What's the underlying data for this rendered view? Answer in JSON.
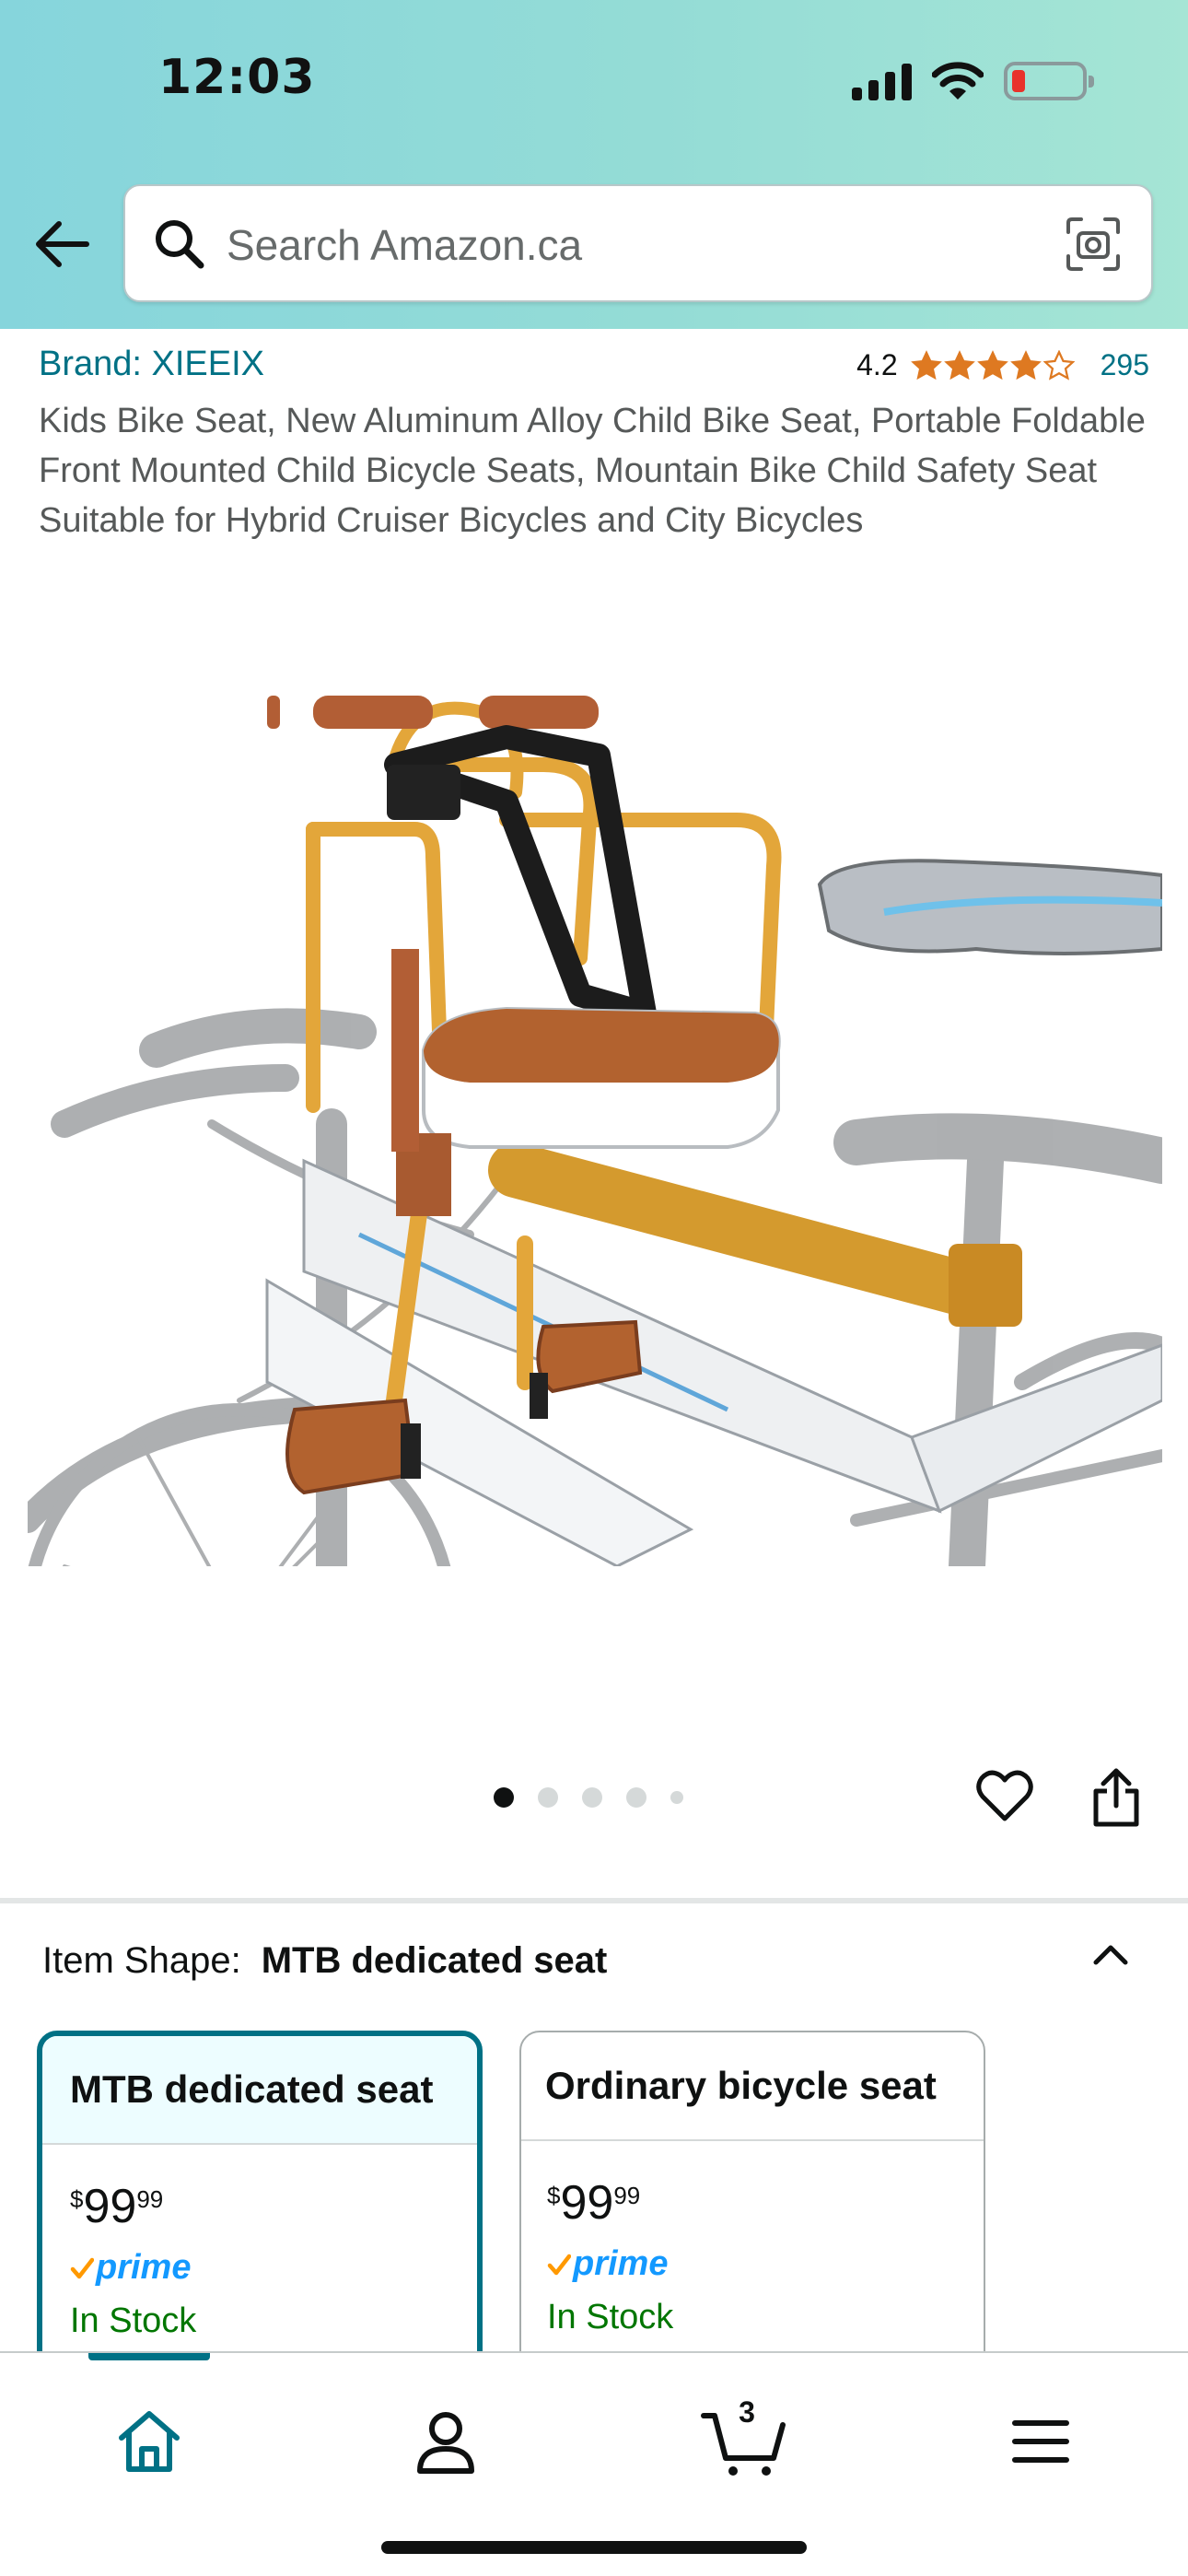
{
  "status_bar": {
    "time": "12:03"
  },
  "search": {
    "placeholder": "Search Amazon.ca"
  },
  "product": {
    "brand": "Brand: XIEEIX",
    "rating": "4.2",
    "rating_stars": 4.2,
    "review_count": "295",
    "title": "Kids Bike Seat, New Aluminum Alloy Child Bike Seat, Portable Foldable Front Mounted Child Bicycle Seats, Mountain Bike Child Safety Seat Suitable for Hybrid Cruiser Bicycles and City Bicycles"
  },
  "carousel": {
    "total": 5,
    "active": 0
  },
  "variation": {
    "label": "Item Shape:",
    "selected_value": "MTB dedicated seat",
    "options": [
      {
        "name": "MTB dedicated seat",
        "currency": "$",
        "price_whole": "99",
        "price_fraction": "99",
        "prime": "prime",
        "stock": "In Stock"
      },
      {
        "name": "Ordinary bicycle seat",
        "currency": "$",
        "price_whole": "99",
        "price_fraction": "99",
        "prime": "prime",
        "stock": "In Stock"
      }
    ]
  },
  "tabbar": {
    "cart_count": "3"
  },
  "colors": {
    "header_gradient": [
      "#86d5dc",
      "#a5e5d5"
    ],
    "link": "#007185",
    "star": "#de7921",
    "prime_blue": "#1399ff",
    "prime_check": "#ff9900",
    "in_stock": "#007600",
    "selected_border": "#007185"
  },
  "icons": [
    "back-arrow-icon",
    "search-icon",
    "camera-icon",
    "heart-icon",
    "share-icon",
    "chevron-up-icon",
    "home-icon",
    "account-icon",
    "cart-icon",
    "menu-icon"
  ]
}
